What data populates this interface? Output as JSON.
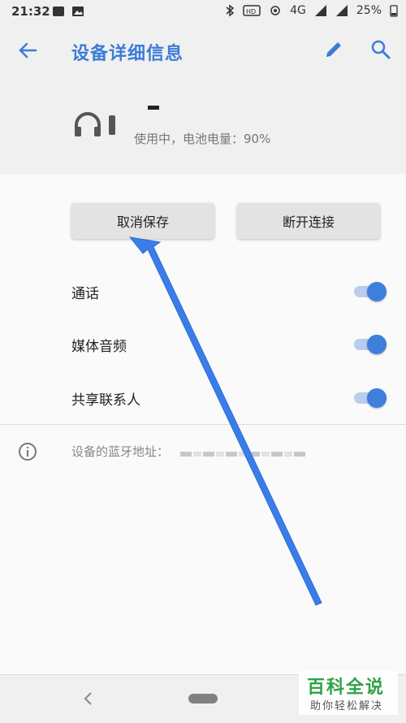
{
  "status_bar": {
    "time": "21:32",
    "battery": "25%",
    "network": "4G"
  },
  "app_bar": {
    "title": "设备详细信息"
  },
  "device": {
    "name": "–",
    "status": "使用中，电池电量：90%"
  },
  "buttons": {
    "forget": "取消保存",
    "disconnect": "断开连接"
  },
  "toggles": [
    {
      "label": "通话",
      "on": true
    },
    {
      "label": "媒体音频",
      "on": true
    },
    {
      "label": "共享联系人",
      "on": true
    }
  ],
  "address": {
    "label": "设备的蓝牙地址："
  },
  "watermark": {
    "title": "百科全说",
    "subtitle": "助你轻松解决"
  },
  "colors": {
    "accent": "#3e7fdc",
    "arrow": "#3b7de8",
    "watermark_green": "#2fa24a"
  }
}
